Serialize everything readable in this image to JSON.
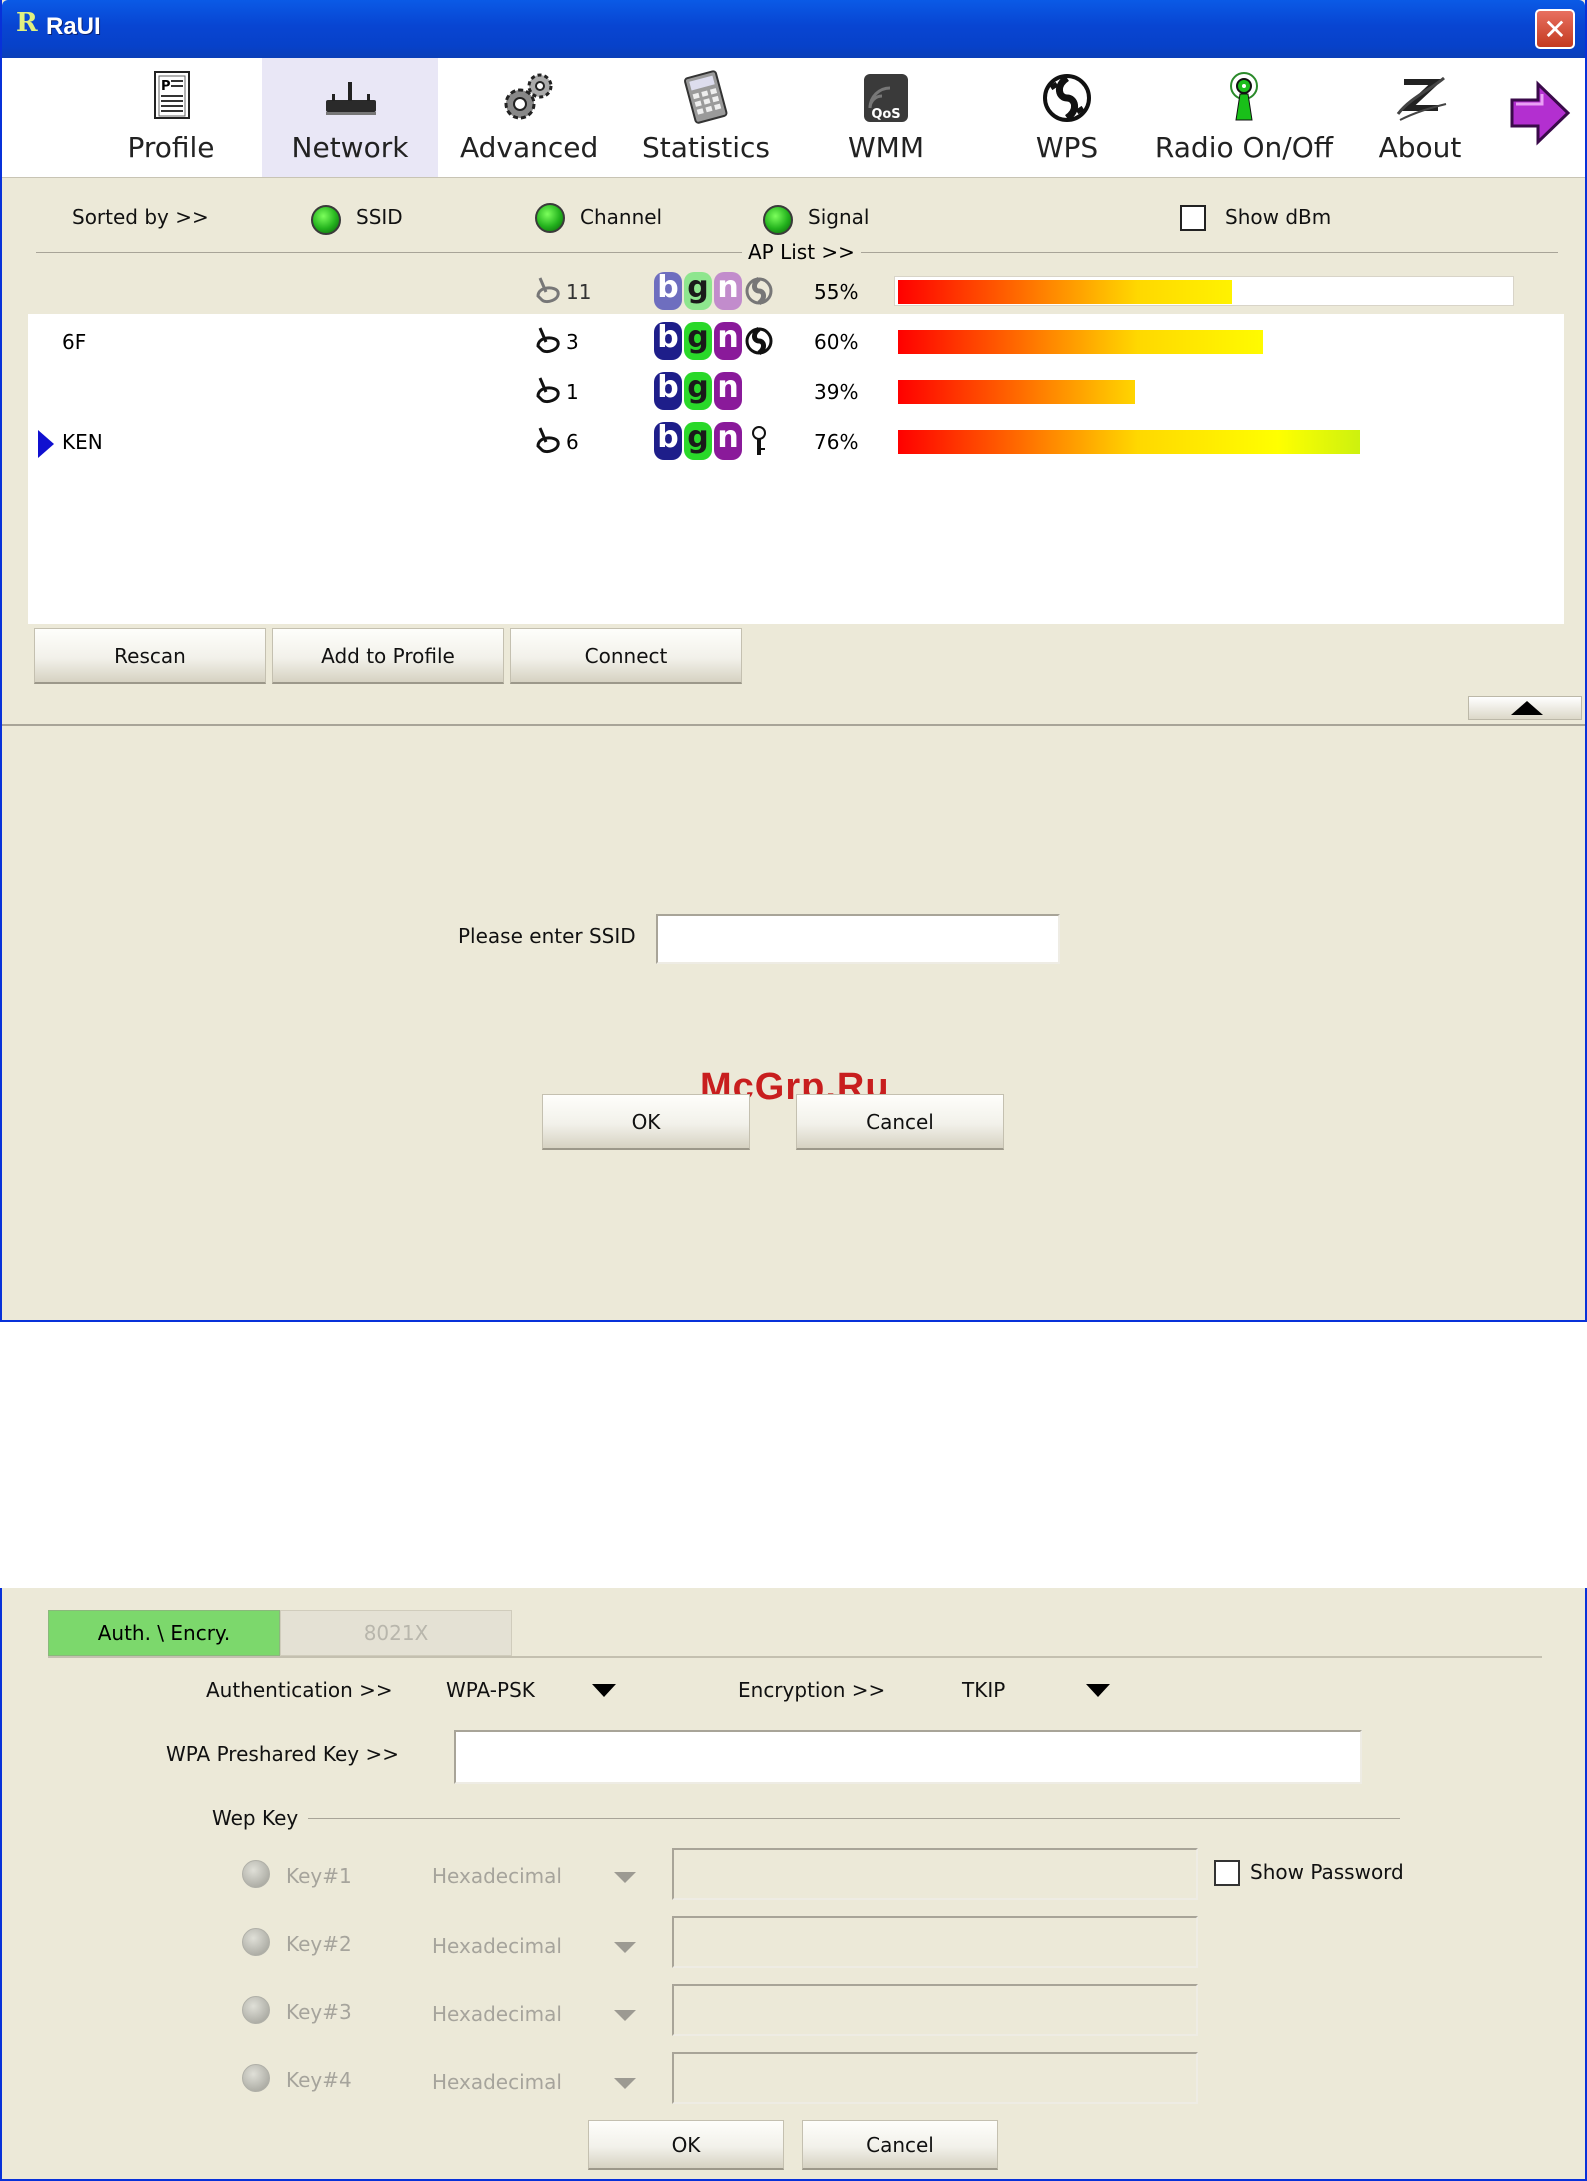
{
  "window": {
    "title": "RaUI",
    "logo": "R"
  },
  "toolbar": {
    "items": [
      {
        "label": "Profile",
        "icon": "profile-icon"
      },
      {
        "label": "Network",
        "icon": "network-icon",
        "active": true
      },
      {
        "label": "Advanced",
        "icon": "advanced-gears-icon"
      },
      {
        "label": "Statistics",
        "icon": "statistics-calculator-icon"
      },
      {
        "label": "WMM",
        "icon": "wmm-qos-icon",
        "badge": "QoS"
      },
      {
        "label": "WPS",
        "icon": "wps-icon"
      },
      {
        "label": "Radio On/Off",
        "icon": "radio-antenna-icon"
      },
      {
        "label": "About",
        "icon": "about-icon"
      }
    ],
    "next_icon": "next-arrow-icon"
  },
  "sort": {
    "label": "Sorted by >>",
    "ssid": "SSID",
    "channel": "Channel",
    "signal": "Signal",
    "show_dbm": "Show dBm"
  },
  "ap_list": {
    "title": "AP List >>",
    "rows": [
      {
        "ssid": "",
        "channel": "11",
        "modes": [
          "b",
          "g",
          "n"
        ],
        "extra_icon": "wps-icon",
        "signal_pct": 55,
        "signal_text": "55%",
        "selected_row": true,
        "connected": false
      },
      {
        "ssid": "6F",
        "channel": "3",
        "modes": [
          "b",
          "g",
          "n"
        ],
        "extra_icon": "wps-icon",
        "signal_pct": 60,
        "signal_text": "60%",
        "selected_row": false,
        "connected": false
      },
      {
        "ssid": "",
        "channel": "1",
        "modes": [
          "b",
          "g",
          "n"
        ],
        "extra_icon": "",
        "signal_pct": 39,
        "signal_text": "39%",
        "selected_row": false,
        "connected": false
      },
      {
        "ssid": "KEN",
        "channel": "6",
        "modes": [
          "b",
          "g",
          "n"
        ],
        "extra_icon": "key-icon",
        "signal_pct": 76,
        "signal_text": "76%",
        "selected_row": false,
        "connected": true
      }
    ]
  },
  "buttons": {
    "rescan": "Rescan",
    "add_to_profile": "Add to Profile",
    "connect": "Connect"
  },
  "ssid_dialog": {
    "label": "Please enter SSID",
    "value": "",
    "ok": "OK",
    "cancel": "Cancel"
  },
  "watermark": "McGrp.Ru",
  "security": {
    "tabs": {
      "auth": "Auth. \\ Encry.",
      "x8021": "8021X"
    },
    "authentication_label": "Authentication >>",
    "authentication_value": "WPA-PSK",
    "encryption_label": "Encryption >>",
    "encryption_value": "TKIP",
    "psk_label": "WPA Preshared Key >>",
    "psk_value": "",
    "wep_label": "Wep Key",
    "wep_keys": [
      {
        "label": "Key#1",
        "format": "Hexadecimal",
        "value": ""
      },
      {
        "label": "Key#2",
        "format": "Hexadecimal",
        "value": ""
      },
      {
        "label": "Key#3",
        "format": "Hexadecimal",
        "value": ""
      },
      {
        "label": "Key#4",
        "format": "Hexadecimal",
        "value": ""
      }
    ],
    "show_password": "Show Password",
    "ok": "OK",
    "cancel": "Cancel"
  }
}
